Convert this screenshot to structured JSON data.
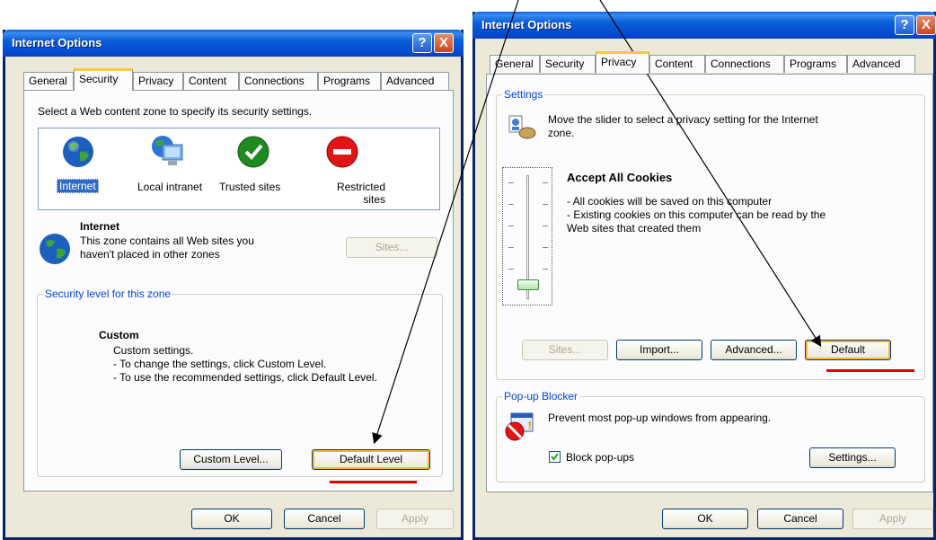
{
  "left_dialog": {
    "title": "Internet Options",
    "help_btn": "?",
    "close_btn": "X",
    "tabs": [
      "General",
      "Security",
      "Privacy",
      "Content",
      "Connections",
      "Programs",
      "Advanced"
    ],
    "active_tab": "Security",
    "zone_prompt": "Select a Web content zone to specify its security settings.",
    "zones": [
      "Internet",
      "Local intranet",
      "Trusted sites",
      "Restricted sites"
    ],
    "selected_zone": "Internet",
    "zone_heading": "Internet",
    "zone_desc_1": "This zone contains all Web sites you",
    "zone_desc_2": "haven't placed in other zones",
    "sites_btn": "Sites...",
    "level_group": "Security level for this zone",
    "level_name": "Custom",
    "level_line1": "Custom settings.",
    "level_line2": "- To change the settings, click Custom Level.",
    "level_line3": "- To use the recommended settings, click Default Level.",
    "custom_level_btn": "Custom Level...",
    "default_level_btn": "Default Level",
    "ok_btn": "OK",
    "cancel_btn": "Cancel",
    "apply_btn": "Apply"
  },
  "right_dialog": {
    "title": "Internet Options",
    "help_btn": "?",
    "close_btn": "X",
    "tabs": [
      "General",
      "Security",
      "Privacy",
      "Content",
      "Connections",
      "Programs",
      "Advanced"
    ],
    "active_tab": "Privacy",
    "settings_group": "Settings",
    "slider_hint_1": "Move the slider to select a privacy setting for the Internet",
    "slider_hint_2": "zone.",
    "level_name": "Accept All Cookies",
    "level_line1": "- All cookies will be saved on this computer",
    "level_line2": "- Existing cookies on this computer can be read by the",
    "level_line3": "Web sites that created them",
    "slider_level": 0,
    "sites_btn": "Sites...",
    "import_btn": "Import...",
    "advanced_btn": "Advanced...",
    "default_btn": "Default",
    "popup_group": "Pop-up Blocker",
    "popup_desc": "Prevent most pop-up windows from appearing.",
    "block_popups_label": "Block pop-ups",
    "block_popups_checked": true,
    "settings_btn": "Settings...",
    "ok_btn": "OK",
    "cancel_btn": "Cancel",
    "apply_btn": "Apply"
  },
  "colors": {
    "titlebar": "#0a5fd8",
    "dialog_bg": "#ece9d8",
    "annotation_red": "#e00000",
    "focus_orange": "#f8b33c"
  }
}
